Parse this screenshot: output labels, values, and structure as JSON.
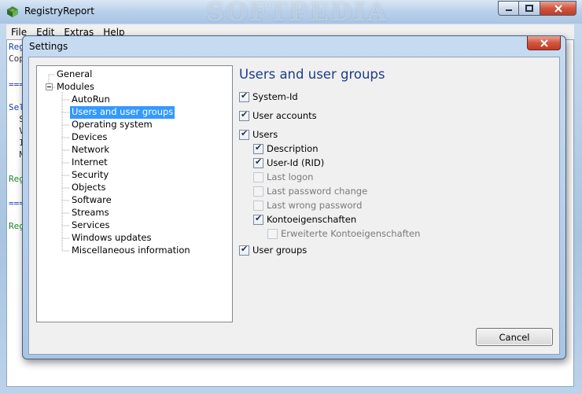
{
  "main_window": {
    "title": "RegistryReport",
    "watermark": "SOFTPEDIA",
    "menu": [
      "File",
      "Edit",
      "Extras",
      "Help"
    ],
    "background_lines": [
      {
        "text": "Reg",
        "color": "blue"
      },
      {
        "text": "Cop",
        "color": "dark"
      },
      {
        "text": "===",
        "color": "blue"
      },
      {
        "text": "Sel",
        "color": "blue"
      },
      {
        "text": "  S",
        "color": "dark"
      },
      {
        "text": "  V",
        "color": "dark"
      },
      {
        "text": "  I",
        "color": "dark"
      },
      {
        "text": "  N",
        "color": "dark"
      },
      {
        "text": "Reg",
        "color": "green"
      },
      {
        "text": "===",
        "color": "blue"
      },
      {
        "text": "Reg",
        "color": "green"
      }
    ]
  },
  "dialog": {
    "title": "Settings",
    "tree": [
      {
        "label": "General",
        "level": 0
      },
      {
        "label": "Modules",
        "level": 0,
        "expanded": true
      },
      {
        "label": "AutoRun",
        "level": 1
      },
      {
        "label": "Users and user groups",
        "level": 1,
        "selected": true
      },
      {
        "label": "Operating system",
        "level": 1
      },
      {
        "label": "Devices",
        "level": 1
      },
      {
        "label": "Network",
        "level": 1
      },
      {
        "label": "Internet",
        "level": 1
      },
      {
        "label": "Security",
        "level": 1
      },
      {
        "label": "Objects",
        "level": 1
      },
      {
        "label": "Software",
        "level": 1
      },
      {
        "label": "Streams",
        "level": 1
      },
      {
        "label": "Services",
        "level": 1
      },
      {
        "label": "Windows updates",
        "level": 1
      },
      {
        "label": "Miscellaneous information",
        "level": 1
      }
    ],
    "panel": {
      "heading": "Users and user groups",
      "options": [
        {
          "label": "System-Id",
          "checked": true,
          "enabled": true,
          "indent": 0
        },
        {
          "label": "User accounts",
          "checked": true,
          "enabled": true,
          "indent": 0
        },
        {
          "label": "Users",
          "checked": true,
          "enabled": true,
          "indent": 0
        },
        {
          "label": "Description",
          "checked": true,
          "enabled": true,
          "indent": 1
        },
        {
          "label": "User-Id (RID)",
          "checked": true,
          "enabled": true,
          "indent": 1
        },
        {
          "label": "Last logon",
          "checked": false,
          "enabled": false,
          "indent": 1
        },
        {
          "label": "Last password change",
          "checked": false,
          "enabled": false,
          "indent": 1
        },
        {
          "label": "Last wrong password",
          "checked": false,
          "enabled": false,
          "indent": 1
        },
        {
          "label": "Kontoeigenschaften",
          "checked": true,
          "enabled": true,
          "indent": 1
        },
        {
          "label": "Erweiterte Kontoeigenschaften",
          "checked": false,
          "enabled": false,
          "indent": 2
        },
        {
          "label": "User groups",
          "checked": true,
          "enabled": true,
          "indent": 0
        }
      ]
    },
    "cancel_label": "Cancel"
  },
  "colors": {
    "selection": "#3399ff",
    "heading": "#1e3a8a",
    "close_button": "#c23a23"
  }
}
